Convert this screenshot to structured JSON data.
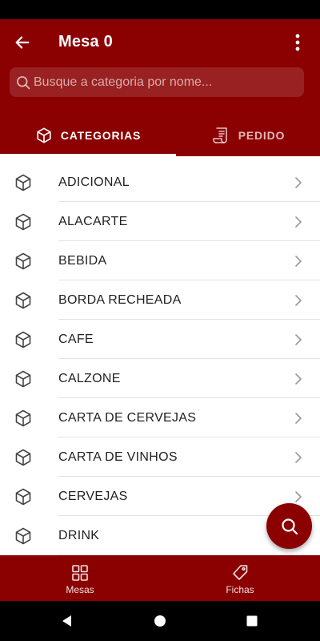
{
  "header": {
    "title": "Mesa 0",
    "back_icon": "arrow-left-icon",
    "menu_icon": "more-vertical-icon"
  },
  "search": {
    "placeholder": "Busque a categoria por nome...",
    "value": "",
    "icon": "search-icon"
  },
  "tabs": [
    {
      "label": "CATEGORIAS",
      "icon": "cube-icon",
      "active": true
    },
    {
      "label": "PEDIDO",
      "icon": "receipt-icon",
      "active": false
    }
  ],
  "categories": [
    {
      "label": "ADICIONAL"
    },
    {
      "label": "ALACARTE"
    },
    {
      "label": "BEBIDA"
    },
    {
      "label": "BORDA RECHEADA"
    },
    {
      "label": "CAFE"
    },
    {
      "label": "CALZONE"
    },
    {
      "label": "CARTA DE CERVEJAS"
    },
    {
      "label": "CARTA DE VINHOS"
    },
    {
      "label": "CERVEJAS"
    },
    {
      "label": "DRINK"
    }
  ],
  "fab": {
    "icon": "search-icon"
  },
  "bottom_nav": [
    {
      "label": "Mesas",
      "icon": "grid-icon"
    },
    {
      "label": "Fichas",
      "icon": "tag-icon"
    }
  ],
  "colors": {
    "primary": "#8b0000",
    "on_primary": "#ffffff",
    "text": "#222222",
    "divider": "#e2e2e2"
  }
}
